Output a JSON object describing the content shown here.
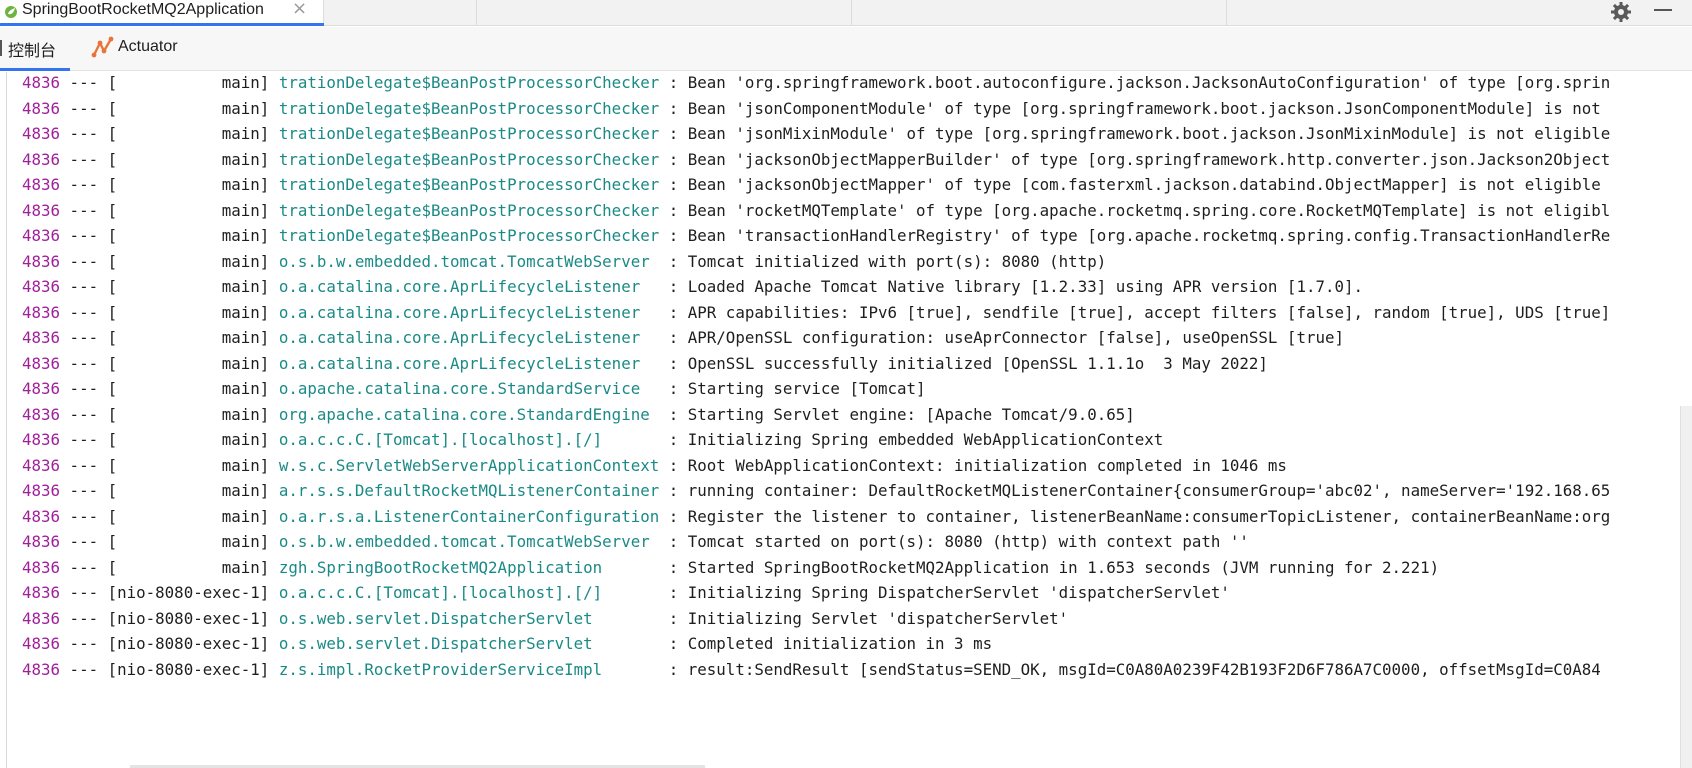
{
  "run_tab": {
    "title": "SpringBootRocketMQ2Application",
    "close": "×",
    "icon": "spring-app-icon"
  },
  "window_controls": {
    "settings": "gear-icon",
    "minimize": "minimize-icon"
  },
  "tool_tabs": [
    {
      "label": "控制台",
      "active": true
    },
    {
      "label": "Actuator",
      "icon": "actuator-icon",
      "active": false
    }
  ],
  "colors": {
    "pid": "#a0209c",
    "logger": "#1a8a86",
    "accent": "#3574f0"
  },
  "log": [
    {
      "pid": "4836",
      "sep": " --- ",
      "thread": "[           main]",
      "logger": "trationDelegate$BeanPostProcessorChecker",
      "msg": " : Bean 'org.springframework.boot.autoconfigure.jackson.JacksonAutoConfiguration' of type [org.sprin"
    },
    {
      "pid": "4836",
      "sep": " --- ",
      "thread": "[           main]",
      "logger": "trationDelegate$BeanPostProcessorChecker",
      "msg": " : Bean 'jsonComponentModule' of type [org.springframework.boot.jackson.JsonComponentModule] is not "
    },
    {
      "pid": "4836",
      "sep": " --- ",
      "thread": "[           main]",
      "logger": "trationDelegate$BeanPostProcessorChecker",
      "msg": " : Bean 'jsonMixinModule' of type [org.springframework.boot.jackson.JsonMixinModule] is not eligible"
    },
    {
      "pid": "4836",
      "sep": " --- ",
      "thread": "[           main]",
      "logger": "trationDelegate$BeanPostProcessorChecker",
      "msg": " : Bean 'jacksonObjectMapperBuilder' of type [org.springframework.http.converter.json.Jackson2Object"
    },
    {
      "pid": "4836",
      "sep": " --- ",
      "thread": "[           main]",
      "logger": "trationDelegate$BeanPostProcessorChecker",
      "msg": " : Bean 'jacksonObjectMapper' of type [com.fasterxml.jackson.databind.ObjectMapper] is not eligible "
    },
    {
      "pid": "4836",
      "sep": " --- ",
      "thread": "[           main]",
      "logger": "trationDelegate$BeanPostProcessorChecker",
      "msg": " : Bean 'rocketMQTemplate' of type [org.apache.rocketmq.spring.core.RocketMQTemplate] is not eligibl"
    },
    {
      "pid": "4836",
      "sep": " --- ",
      "thread": "[           main]",
      "logger": "trationDelegate$BeanPostProcessorChecker",
      "msg": " : Bean 'transactionHandlerRegistry' of type [org.apache.rocketmq.spring.config.TransactionHandlerRe"
    },
    {
      "pid": "4836",
      "sep": " --- ",
      "thread": "[           main]",
      "logger": "o.s.b.w.embedded.tomcat.TomcatWebServer ",
      "msg": " : Tomcat initialized with port(s): 8080 (http)"
    },
    {
      "pid": "4836",
      "sep": " --- ",
      "thread": "[           main]",
      "logger": "o.a.catalina.core.AprLifecycleListener  ",
      "msg": " : Loaded Apache Tomcat Native library [1.2.33] using APR version [1.7.0]."
    },
    {
      "pid": "4836",
      "sep": " --- ",
      "thread": "[           main]",
      "logger": "o.a.catalina.core.AprLifecycleListener  ",
      "msg": " : APR capabilities: IPv6 [true], sendfile [true], accept filters [false], random [true], UDS [true]"
    },
    {
      "pid": "4836",
      "sep": " --- ",
      "thread": "[           main]",
      "logger": "o.a.catalina.core.AprLifecycleListener  ",
      "msg": " : APR/OpenSSL configuration: useAprConnector [false], useOpenSSL [true]"
    },
    {
      "pid": "4836",
      "sep": " --- ",
      "thread": "[           main]",
      "logger": "o.a.catalina.core.AprLifecycleListener  ",
      "msg": " : OpenSSL successfully initialized [OpenSSL 1.1.1o  3 May 2022]"
    },
    {
      "pid": "4836",
      "sep": " --- ",
      "thread": "[           main]",
      "logger": "o.apache.catalina.core.StandardService  ",
      "msg": " : Starting service [Tomcat]"
    },
    {
      "pid": "4836",
      "sep": " --- ",
      "thread": "[           main]",
      "logger": "org.apache.catalina.core.StandardEngine ",
      "msg": " : Starting Servlet engine: [Apache Tomcat/9.0.65]"
    },
    {
      "pid": "4836",
      "sep": " --- ",
      "thread": "[           main]",
      "logger": "o.a.c.c.C.[Tomcat].[localhost].[/]      ",
      "msg": " : Initializing Spring embedded WebApplicationContext"
    },
    {
      "pid": "4836",
      "sep": " --- ",
      "thread": "[           main]",
      "logger": "w.s.c.ServletWebServerApplicationContext",
      "msg": " : Root WebApplicationContext: initialization completed in 1046 ms"
    },
    {
      "pid": "4836",
      "sep": " --- ",
      "thread": "[           main]",
      "logger": "a.r.s.s.DefaultRocketMQListenerContainer",
      "msg": " : running container: DefaultRocketMQListenerContainer{consumerGroup='abc02', nameServer='192.168.65"
    },
    {
      "pid": "4836",
      "sep": " --- ",
      "thread": "[           main]",
      "logger": "o.a.r.s.a.ListenerContainerConfiguration",
      "msg": " : Register the listener to container, listenerBeanName:consumerTopicListener, containerBeanName:org"
    },
    {
      "pid": "4836",
      "sep": " --- ",
      "thread": "[           main]",
      "logger": "o.s.b.w.embedded.tomcat.TomcatWebServer ",
      "msg": " : Tomcat started on port(s): 8080 (http) with context path ''"
    },
    {
      "pid": "4836",
      "sep": " --- ",
      "thread": "[           main]",
      "logger": "zgh.SpringBootRocketMQ2Application      ",
      "msg": " : Started SpringBootRocketMQ2Application in 1.653 seconds (JVM running for 2.221)"
    },
    {
      "pid": "4836",
      "sep": " --- ",
      "thread": "[nio-8080-exec-1]",
      "logger": "o.a.c.c.C.[Tomcat].[localhost].[/]      ",
      "msg": " : Initializing Spring DispatcherServlet 'dispatcherServlet'"
    },
    {
      "pid": "4836",
      "sep": " --- ",
      "thread": "[nio-8080-exec-1]",
      "logger": "o.s.web.servlet.DispatcherServlet       ",
      "msg": " : Initializing Servlet 'dispatcherServlet'"
    },
    {
      "pid": "4836",
      "sep": " --- ",
      "thread": "[nio-8080-exec-1]",
      "logger": "o.s.web.servlet.DispatcherServlet       ",
      "msg": " : Completed initialization in 3 ms"
    },
    {
      "pid": "4836",
      "sep": " --- ",
      "thread": "[nio-8080-exec-1]",
      "logger": "z.s.impl.RocketProviderServiceImpl      ",
      "msg": " : result:SendResult [sendStatus=SEND_OK, msgId=C0A80A0239F42B193F2D6F786A7C0000, offsetMsgId=C0A84"
    }
  ]
}
